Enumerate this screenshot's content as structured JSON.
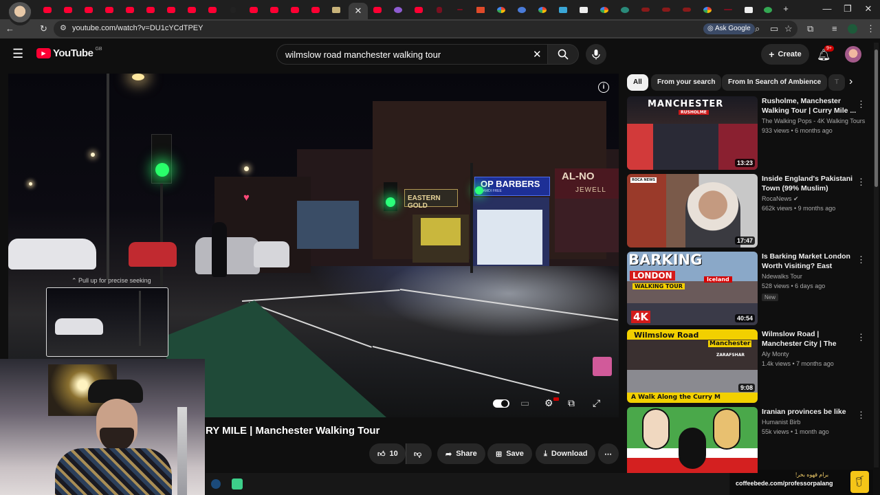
{
  "browser": {
    "url": "youtube.com/watch?v=DU1cYCdTPEY",
    "ask_google": "Ask Google"
  },
  "yt": {
    "logo_text": "YouTube",
    "region": "GB",
    "search_value": "wilmslow road manchester walking tour",
    "create_label": "Create",
    "notif_count": "9+"
  },
  "video": {
    "title": "RY MILE | Manchester Walking Tour",
    "pull_hint": "Pull up for precise seeking",
    "likes": "10",
    "share": "Share",
    "save": "Save",
    "download": "Download"
  },
  "chips": [
    {
      "label": "All"
    },
    {
      "label": "From your search"
    },
    {
      "label": "From In Search of Ambience"
    },
    {
      "label": "T"
    }
  ],
  "recs": [
    {
      "title": "Rusholme, Manchester Walking Tour | Curry Mile ...",
      "channel": "The Walking Pops - 4K Walking Tours",
      "meta": "933 views • 6 months ago",
      "duration": "13:23",
      "badge": ""
    },
    {
      "title": "Inside England's Pakistani Town (99% Muslim)",
      "channel": "RocaNews",
      "meta": "662k views • 9 months ago",
      "duration": "17:47",
      "badge": ""
    },
    {
      "title": "Is Barking Market London Worth Visiting? East Londo...",
      "channel": "Ndewalks Tour",
      "meta": "528 views • 6 days ago",
      "duration": "40:54",
      "badge": "New"
    },
    {
      "title": "Wilmslow Road | Manchester City | The Curr...",
      "channel": "Aly Monty",
      "meta": "1.4k views • 7 months ago",
      "duration": "9:08",
      "badge": ""
    },
    {
      "title": "Iranian provinces be like",
      "channel": "Humanist Birb",
      "meta": "55k views • 1 month ago",
      "duration": "",
      "badge": ""
    }
  ],
  "thumb_text": {
    "manchester": "MANCHESTER",
    "rusholme": "RUSHOLME",
    "roca": "ROCA NEWS",
    "barking": "BARKING",
    "london": "LONDON",
    "walking_tour": "WALKING TOUR",
    "iceland": "Iceland",
    "fourk": "4K",
    "wilmslow": "Wilmslow Road",
    "manchester2": "Manchester",
    "zarafshar": "ZARAFSHAR",
    "curry": "A Walk Along the Curry M"
  },
  "scene_text": {
    "barbers": "OP BARBERS",
    "barbers_sub": "HAMDI  FREE",
    "eastern_gold": "EASTERN GOLD",
    "al_nor": "AL-NO",
    "jewell": "JEWELL"
  },
  "coffee": {
    "line1": "برام قهوه بخر!",
    "line2": "coffeebede.com/professorpalang"
  },
  "colors": {
    "yt_red": "#ff0033",
    "bg": "#0f0f0f",
    "chip_bg": "#272727"
  }
}
